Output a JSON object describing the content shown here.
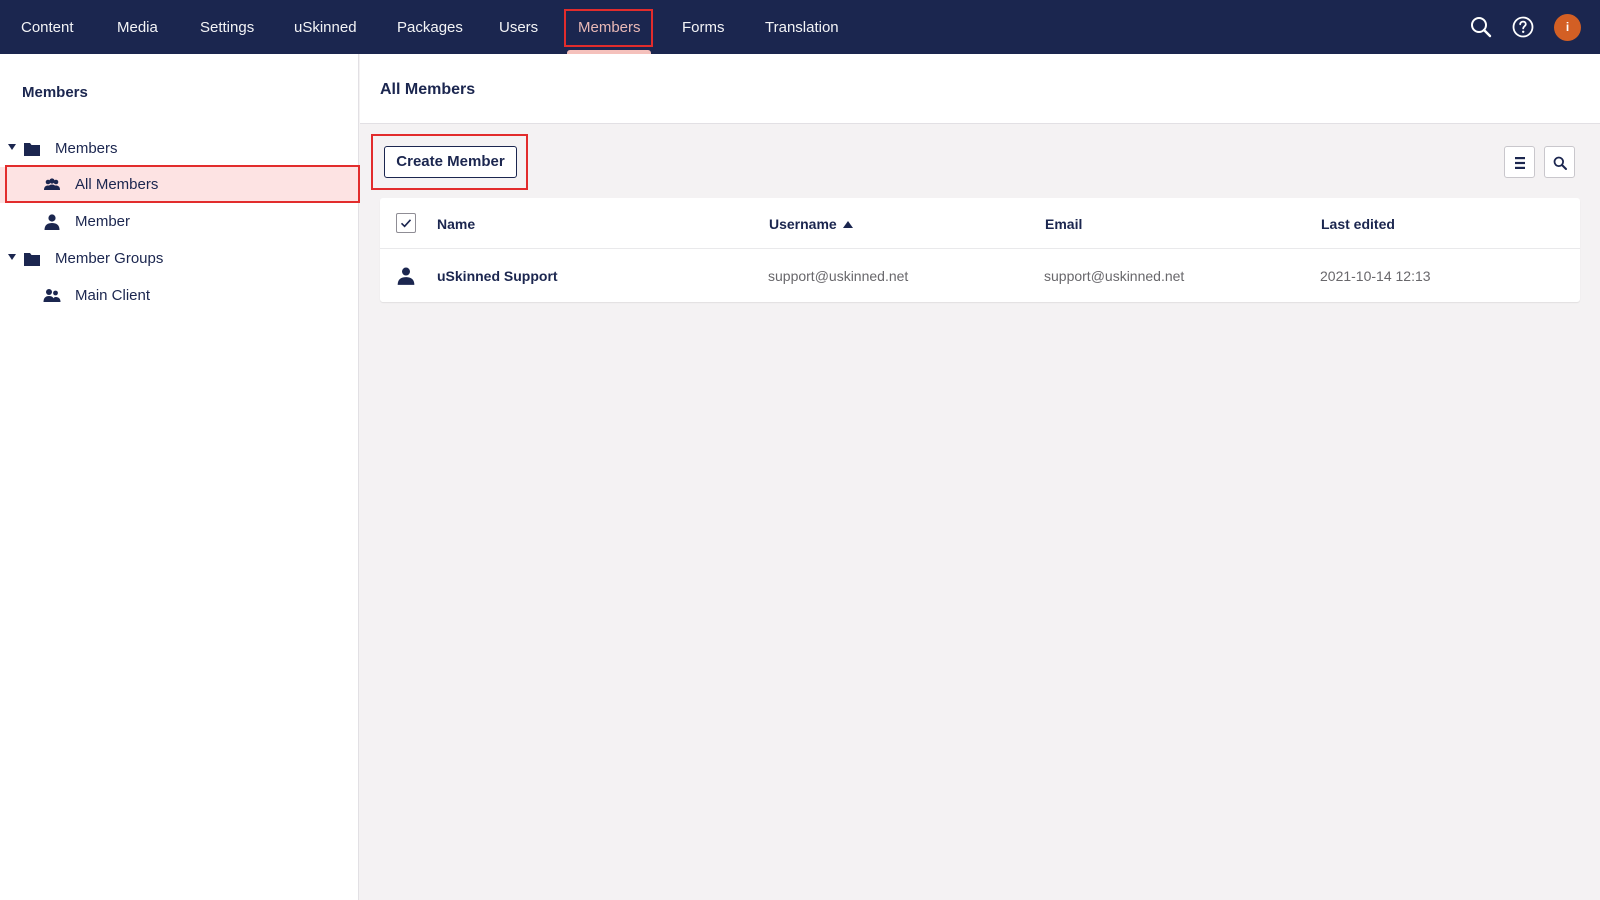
{
  "topnav": {
    "items": [
      {
        "label": "Content"
      },
      {
        "label": "Media"
      },
      {
        "label": "Settings"
      },
      {
        "label": "uSkinned"
      },
      {
        "label": "Packages"
      },
      {
        "label": "Users"
      },
      {
        "label": "Members"
      },
      {
        "label": "Forms"
      },
      {
        "label": "Translation"
      }
    ],
    "active_index": 6,
    "icons": [
      "search-icon",
      "help-icon",
      "user-avatar"
    ],
    "avatar_text": "i"
  },
  "sidebar": {
    "title": "Members",
    "tree": [
      {
        "label": "Members",
        "icon": "folder-icon",
        "expanded": true
      },
      {
        "label": "All Members",
        "icon": "members-group-icon",
        "selected": true
      },
      {
        "label": "Member",
        "icon": "member-icon"
      },
      {
        "label": "Member Groups",
        "icon": "folder-icon",
        "expanded": true
      },
      {
        "label": "Main Client",
        "icon": "member-group-icon"
      }
    ]
  },
  "main": {
    "title": "All Members",
    "create_button": "Create Member",
    "toolbar_icons": [
      "list-view-icon",
      "search-icon"
    ],
    "table": {
      "columns": [
        "Name",
        "Username",
        "Email",
        "Last edited"
      ],
      "sort_column": "Username",
      "sort_direction": "ascending",
      "rows": [
        {
          "name": "uSkinned Support",
          "username": "support@uskinned.net",
          "email": "support@uskinned.net",
          "last_edited": "2021-10-14 12:13"
        }
      ]
    }
  },
  "colors": {
    "topbar": "#1b264f",
    "active_nav": "#f5c1bc",
    "highlight": "#e22c2c",
    "selected_row": "#fde3e3",
    "avatar": "#d35f24"
  }
}
